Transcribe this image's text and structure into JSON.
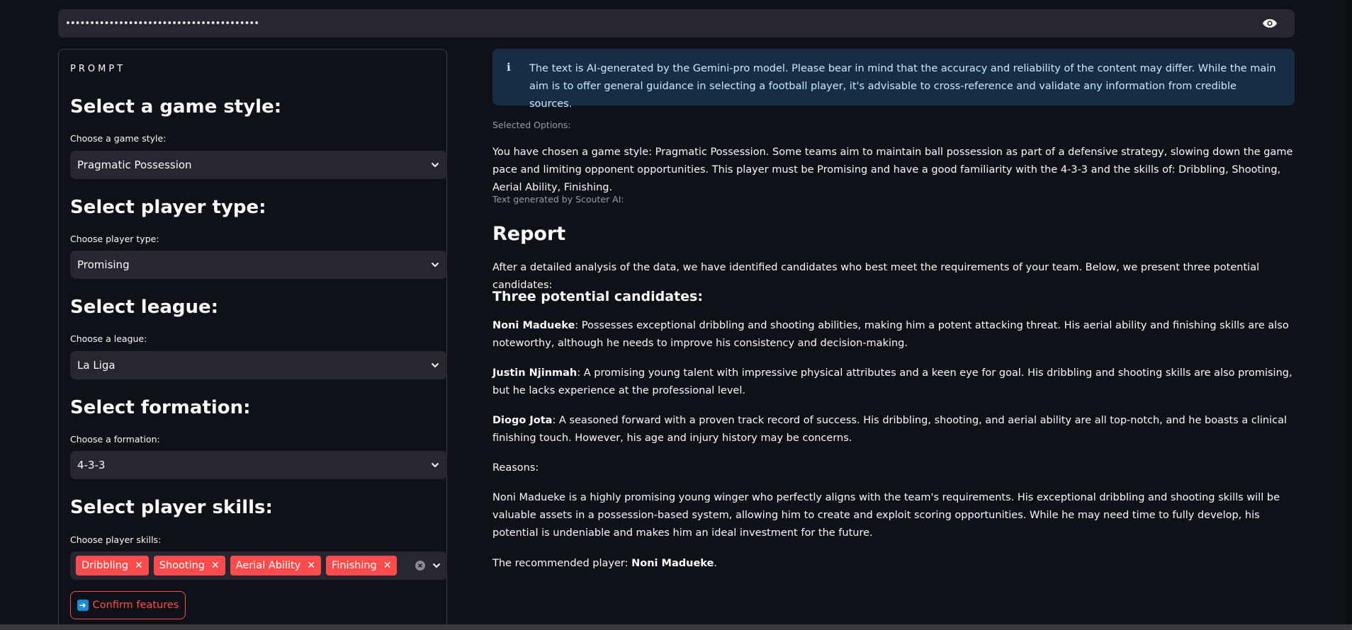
{
  "api_key": {
    "masked_value": "••••••••••••••••••••••••••••••••••••••••",
    "toggle_icon": "eye-icon"
  },
  "sidebar": {
    "caption": "PROMPT",
    "sections": [
      {
        "title": "Select a game style:",
        "label": "Choose a game style:",
        "value": "Pragmatic Possession"
      },
      {
        "title": "Select player type:",
        "label": "Choose player type:",
        "value": "Promising"
      },
      {
        "title": "Select league:",
        "label": "Choose a league:",
        "value": "La Liga"
      },
      {
        "title": "Select formation:",
        "label": "Choose a formation:",
        "value": "4-3-3"
      }
    ],
    "skills": {
      "title": "Select player skills:",
      "label": "Choose player skills:",
      "tags": [
        "Dribbling",
        "Shooting",
        "Aerial Ability",
        "Finishing"
      ]
    },
    "confirm_label": "Confirm features"
  },
  "info_message": "The text is AI-generated by the Gemini-pro model. Please bear in mind that the accuracy and reliability of the content may differ. While the main aim is to offer general guidance in selecting a football player, it's advisable to cross-reference and validate any information from credible sources.",
  "selected_options_label": "Selected Options:",
  "selected_options_text": "You have chosen a game style: Pragmatic Possession. Some teams aim to maintain ball possession as part of a defensive strategy, slowing down the game pace and limiting opponent opportunities. This player must be Promising and have a good familiarity with the 4-3-3 and the skills of: Dribbling, Shooting, Aerial Ability, Finishing.",
  "generated_label": "Text generated by Scouter AI:",
  "report": {
    "title": "Report",
    "intro": "After a detailed analysis of the data, we have identified candidates who best meet the requirements of your team. Below, we present three potential candidates:",
    "subtitle": "Three potential candidates:",
    "candidates": [
      {
        "name": "Noni Madueke",
        "text": ": Possesses exceptional dribbling and shooting abilities, making him a potent attacking threat. His aerial ability and finishing skills are also noteworthy, although he needs to improve his consistency and decision-making."
      },
      {
        "name": "Justin Njinmah",
        "text": ": A promising young talent with impressive physical attributes and a keen eye for goal. His dribbling and shooting skills are also promising, but he lacks experience at the professional level."
      },
      {
        "name": "Diogo Jota",
        "text": ": A seasoned forward with a proven track record of success. His dribbling, shooting, and aerial ability are all top-notch, and he boasts a clinical finishing touch. However, his age and injury history may be concerns."
      }
    ],
    "reasons_label": "Reasons:",
    "reasons_text": "Noni Madueke is a highly promising young winger who perfectly aligns with the team's requirements. His exceptional dribbling and shooting skills will be valuable assets in a possession-based system, allowing him to create and exploit scoring opportunities. While he may need time to fully develop, his potential is undeniable and makes him an ideal investment for the future.",
    "recommended_prefix": "The recommended player: ",
    "recommended_name": "Noni Madueke",
    "recommended_suffix": "."
  },
  "colors": {
    "accent": "#ff4b4b",
    "info_bg": "#172d43",
    "info_text": "#c7ebff",
    "input_bg": "#262730",
    "page_bg": "#0e1117"
  }
}
